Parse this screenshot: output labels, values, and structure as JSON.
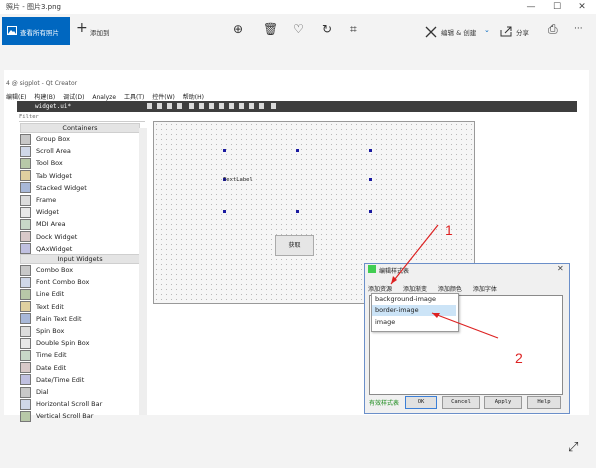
{
  "window": {
    "title": "照片 - 图片3.png",
    "controls": {
      "minimize": "—",
      "maximize": "☐",
      "close": "✕"
    }
  },
  "toolbar": {
    "view_all_label": "查看所有照片",
    "add_to_label": "添加到",
    "add_icon": "+",
    "zoom_icon": "⊕",
    "delete_icon": "🗑",
    "favorite_icon": "♡",
    "rotate_icon": "↻",
    "crop_icon": "⌗",
    "edit_label": "编辑 & 创建",
    "share_label": "分享",
    "print_icon": "⎙",
    "more_icon": "···"
  },
  "qt": {
    "window_title": "4 @ sigplot - Qt Creator",
    "menu": [
      "编辑(E)",
      "构建(B)",
      "调试(D)",
      "Analyze",
      "工具(T)",
      "控件(W)",
      "帮助(H)"
    ],
    "file_tab": "widget.ui*",
    "filter_placeholder": "Filter",
    "categories": [
      "Containers",
      "Input Widgets"
    ],
    "containers": [
      "Group Box",
      "Scroll Area",
      "Tool Box",
      "Tab Widget",
      "Stacked Widget",
      "Frame",
      "Widget",
      "MDI Area",
      "Dock Widget",
      "QAxWidget"
    ],
    "inputs": [
      "Combo Box",
      "Font Combo Box",
      "Line Edit",
      "Text Edit",
      "Plain Text Edit",
      "Spin Box",
      "Double Spin Box",
      "Time Edit",
      "Date Edit",
      "Date/Time Edit",
      "Dial",
      "Horizontal Scroll Bar",
      "Vertical Scroll Bar"
    ],
    "canvas_label": "TextLabel",
    "canvas_button": "获取"
  },
  "dialog": {
    "title": "编辑样式表",
    "toolbar": [
      "添加资源",
      "添加渐变",
      "添加颜色",
      "添加字体"
    ],
    "menu_items": [
      "background-image",
      "border-image",
      "image"
    ],
    "selected_item": "border-image",
    "valid_label": "有效样式表",
    "buttons": {
      "ok": "OK",
      "cancel": "Cancel",
      "apply": "Apply",
      "help": "Help"
    }
  },
  "annotations": {
    "n1": "1",
    "n2": "2"
  },
  "colors": {
    "accent": "#0067c0",
    "highlight": "#cce4f7",
    "annotation": "#dd2222"
  }
}
